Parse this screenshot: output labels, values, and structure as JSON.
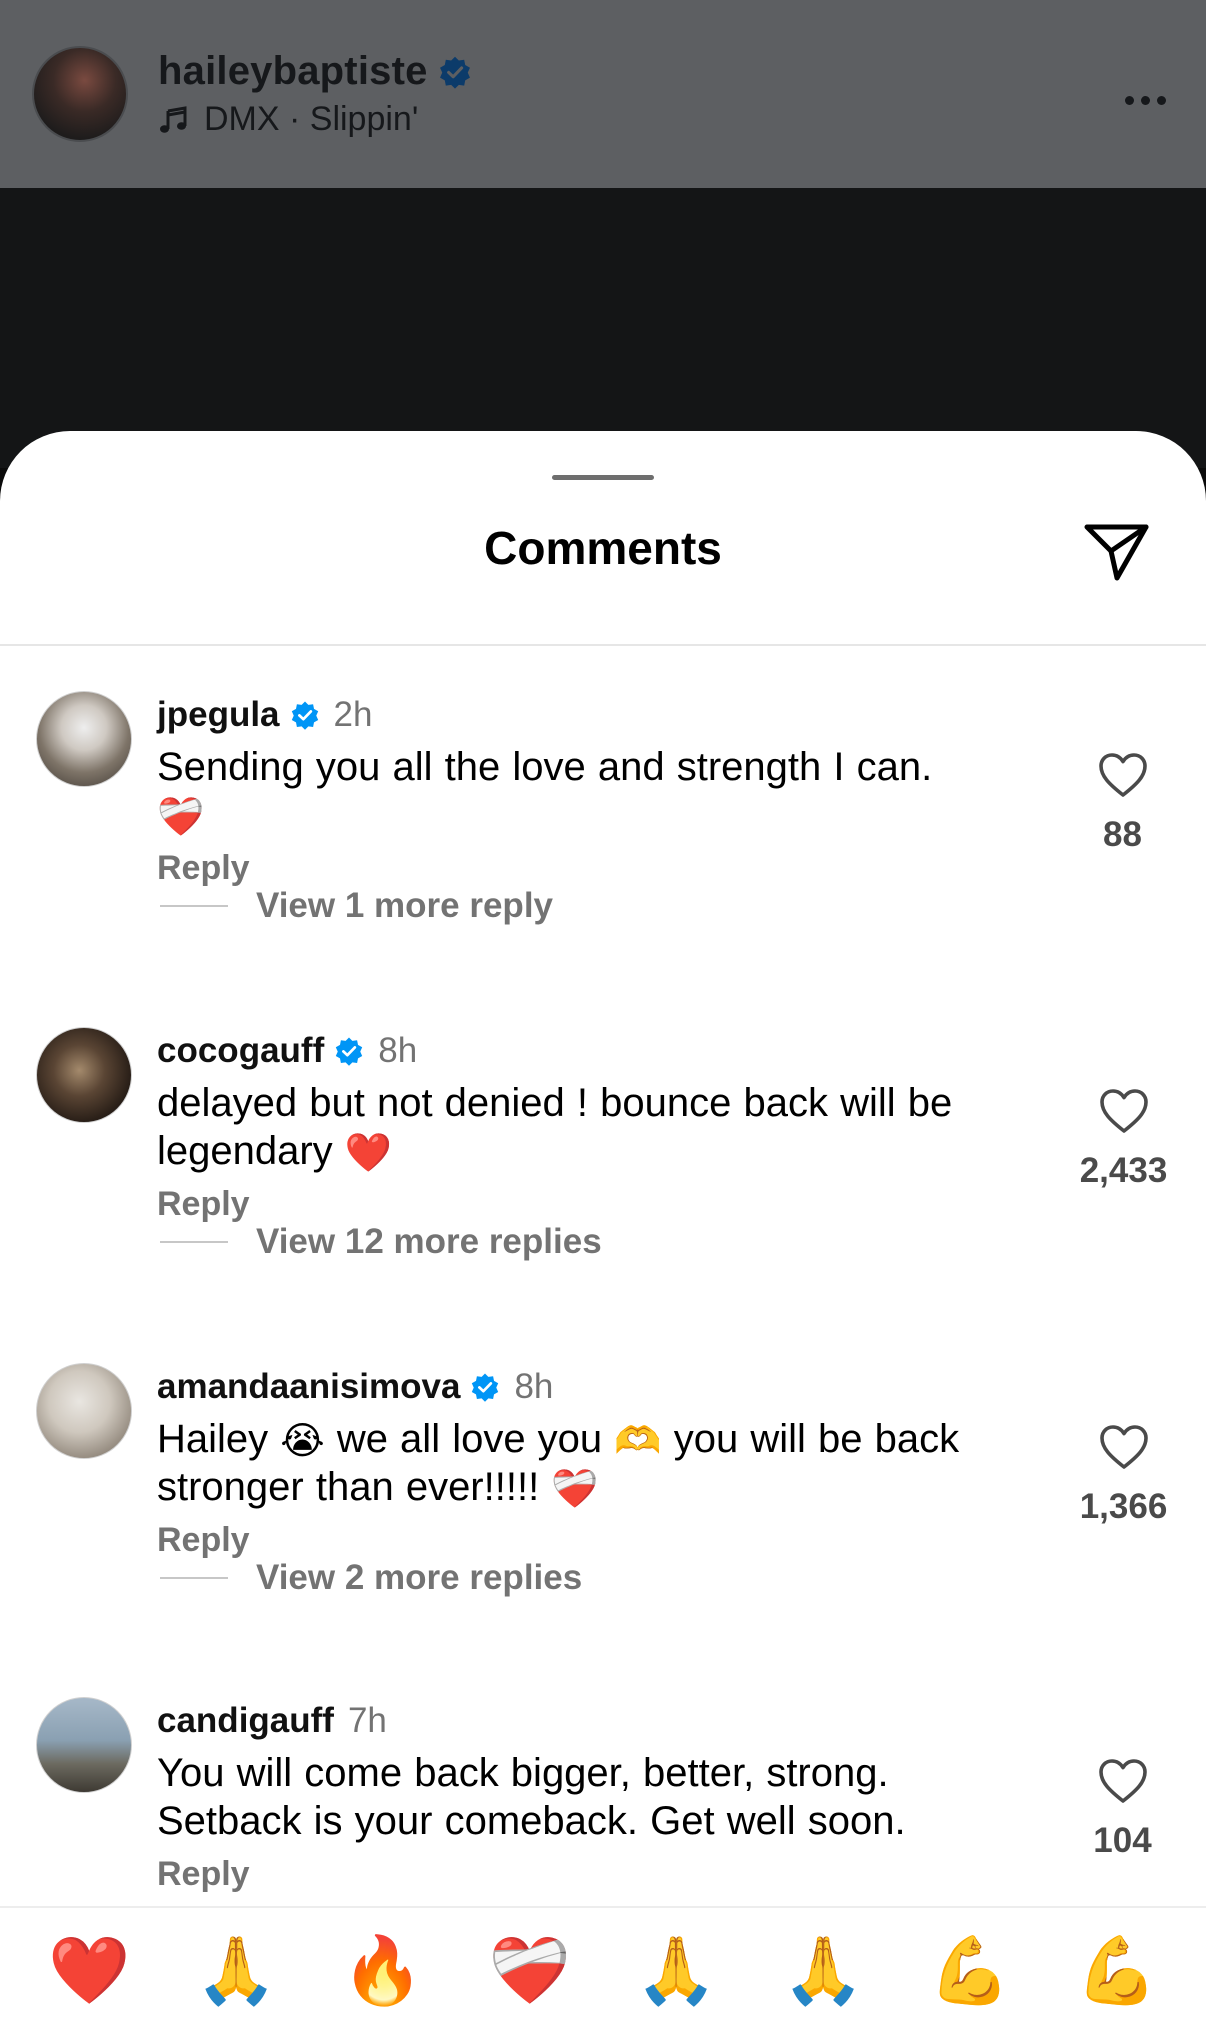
{
  "post": {
    "username": "haileybaptiste",
    "audio": "DMX · Slippin'"
  },
  "sheet": {
    "title": "Comments"
  },
  "comments": [
    {
      "username": "jpegula",
      "verified": true,
      "time": "2h",
      "text": "Sending you all the love and strength I can.",
      "emoji": "❤️‍🩹",
      "reply_label": "Reply",
      "view_replies": "View 1 more reply",
      "likes": "88"
    },
    {
      "username": "cocogauff",
      "verified": true,
      "time": "8h",
      "text_line1": "delayed but not denied ! bounce back will be",
      "text_line2": "legendary",
      "emoji": "❤️",
      "reply_label": "Reply",
      "view_replies": "View 12 more replies",
      "likes": "2,433"
    },
    {
      "username": "amandaanisimova",
      "verified": true,
      "time": "8h",
      "part1": "Hailey",
      "emoji1": "😭",
      "part2": "we all love you",
      "emoji2": "🫶",
      "part3": "you will be back",
      "part4": "stronger than ever!!!!!",
      "emoji3": "❤️‍🩹",
      "reply_label": "Reply",
      "view_replies": "View 2 more replies",
      "likes": "1,366"
    },
    {
      "username": "candigauff",
      "verified": false,
      "time": "7h",
      "text_line1": "You will come back bigger, better, strong.",
      "text_line2": "Setback is your comeback. Get well soon.",
      "reply_label": "Reply",
      "likes": "104"
    }
  ],
  "emoji_bar": [
    "❤️",
    "🙏",
    "🔥",
    "❤️‍🩹",
    "🙏",
    "🙏",
    "💪",
    "💪"
  ],
  "colors": {
    "verified_blue": "#0095f6",
    "secondary_text": "#737373"
  },
  "icons": {
    "verified": "verified-badge-icon",
    "music": "music-note-icon",
    "more": "more-options-icon",
    "share": "share-icon",
    "like": "heart-outline-icon"
  }
}
